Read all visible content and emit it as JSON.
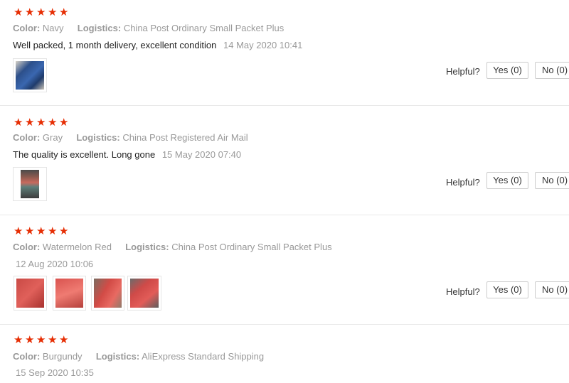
{
  "reviews": [
    {
      "color_label": "Color:",
      "color": "Navy",
      "logistics_label": "Logistics:",
      "logistics": "China Post Ordinary Small Packet Plus",
      "text": "Well packed, 1 month delivery, excellent condition",
      "date": "14 May 2020 10:41",
      "helpful_label": "Helpful?",
      "yes_label": "Yes (0)",
      "no_label": "No (0)"
    },
    {
      "color_label": "Color:",
      "color": "Gray",
      "logistics_label": "Logistics:",
      "logistics": "China Post Registered Air Mail",
      "text": "The quality is excellent. Long gone",
      "date": "15 May 2020 07:40",
      "helpful_label": "Helpful?",
      "yes_label": "Yes (0)",
      "no_label": "No (0)"
    },
    {
      "color_label": "Color:",
      "color": "Watermelon Red",
      "logistics_label": "Logistics:",
      "logistics": "China Post Ordinary Small Packet Plus",
      "date": "12 Aug 2020 10:06",
      "helpful_label": "Helpful?",
      "yes_label": "Yes (0)",
      "no_label": "No (0)"
    },
    {
      "color_label": "Color:",
      "color": "Burgundy",
      "logistics_label": "Logistics:",
      "logistics": "AliExpress Standard Shipping",
      "date": "15 Sep 2020 10:35"
    }
  ],
  "rating_stars": "★★★★★",
  "colors": {
    "star": "#e62e04",
    "muted": "#999999",
    "border": "#cccccc"
  },
  "icons": {
    "star": "star-icon"
  }
}
